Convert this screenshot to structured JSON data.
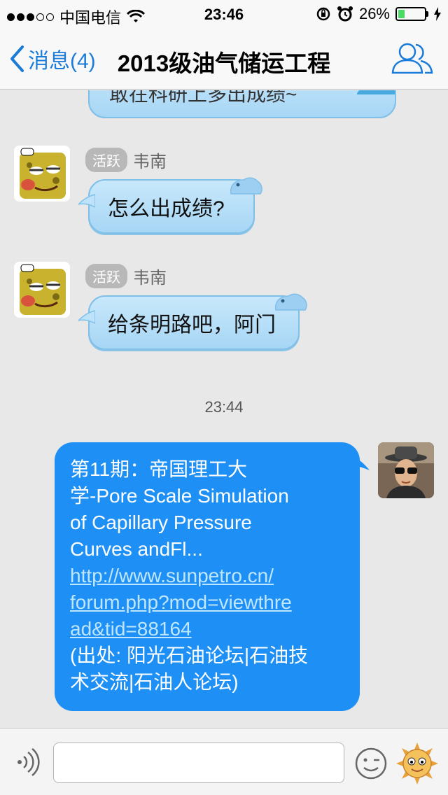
{
  "status_bar": {
    "carrier": "中国电信",
    "time": "23:46",
    "battery_percent": "26%",
    "battery_level": 0.26,
    "signal_bars_filled": 3,
    "signal_bars_total": 5
  },
  "nav": {
    "back_label": "消息(4)",
    "title": "2013级油气储运工程"
  },
  "messages": [
    {
      "text": "敢在科研上多出成绩~"
    },
    {
      "badge": "活跃",
      "sender": "韦南",
      "text": "怎么出成绩?"
    },
    {
      "badge": "活跃",
      "sender": "韦南",
      "text": "给条明路吧，阿门"
    }
  ],
  "timestamp": "23:44",
  "my_message": {
    "line1": "第11期：帝国理工大",
    "line2": "学-Pore Scale Simulation",
    "line3": "of Capillary Pressure",
    "line4": "Curves andFl...",
    "link1": "http://www.sunpetro.cn/",
    "link2": "forum.php?mod=viewthre",
    "link3": "ad&tid=88164",
    "source1": "(出处: 阳光石油论坛|石油技",
    "source2": "术交流|石油人论坛)"
  },
  "input": {
    "placeholder": ""
  },
  "colors": {
    "accent": "#1a7bd9",
    "my_bubble": "#1e90f5",
    "link": "#bfe6ff",
    "battery": "#4cd964"
  }
}
